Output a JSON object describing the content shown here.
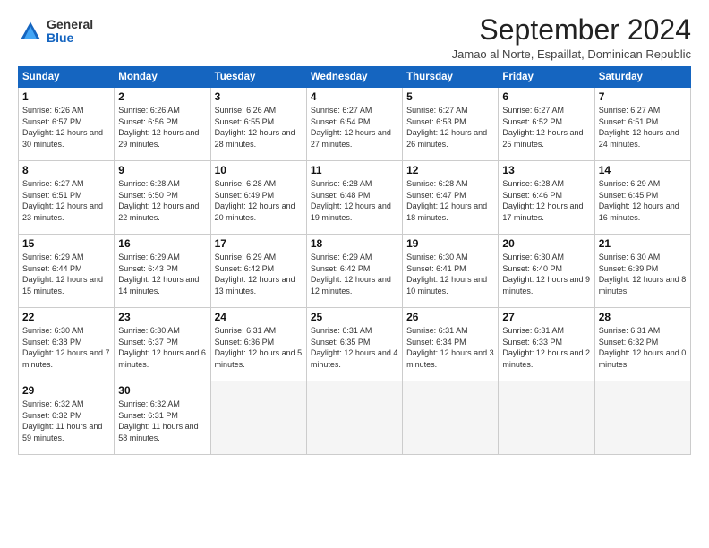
{
  "logo": {
    "general": "General",
    "blue": "Blue"
  },
  "header": {
    "title": "September 2024",
    "subtitle": "Jamao al Norte, Espaillat, Dominican Republic"
  },
  "weekdays": [
    "Sunday",
    "Monday",
    "Tuesday",
    "Wednesday",
    "Thursday",
    "Friday",
    "Saturday"
  ],
  "weeks": [
    [
      {
        "day": 1,
        "sunrise": "6:26 AM",
        "sunset": "6:57 PM",
        "daylight": "12 hours and 30 minutes."
      },
      {
        "day": 2,
        "sunrise": "6:26 AM",
        "sunset": "6:56 PM",
        "daylight": "12 hours and 29 minutes."
      },
      {
        "day": 3,
        "sunrise": "6:26 AM",
        "sunset": "6:55 PM",
        "daylight": "12 hours and 28 minutes."
      },
      {
        "day": 4,
        "sunrise": "6:27 AM",
        "sunset": "6:54 PM",
        "daylight": "12 hours and 27 minutes."
      },
      {
        "day": 5,
        "sunrise": "6:27 AM",
        "sunset": "6:53 PM",
        "daylight": "12 hours and 26 minutes."
      },
      {
        "day": 6,
        "sunrise": "6:27 AM",
        "sunset": "6:52 PM",
        "daylight": "12 hours and 25 minutes."
      },
      {
        "day": 7,
        "sunrise": "6:27 AM",
        "sunset": "6:51 PM",
        "daylight": "12 hours and 24 minutes."
      }
    ],
    [
      {
        "day": 8,
        "sunrise": "6:27 AM",
        "sunset": "6:51 PM",
        "daylight": "12 hours and 23 minutes."
      },
      {
        "day": 9,
        "sunrise": "6:28 AM",
        "sunset": "6:50 PM",
        "daylight": "12 hours and 22 minutes."
      },
      {
        "day": 10,
        "sunrise": "6:28 AM",
        "sunset": "6:49 PM",
        "daylight": "12 hours and 20 minutes."
      },
      {
        "day": 11,
        "sunrise": "6:28 AM",
        "sunset": "6:48 PM",
        "daylight": "12 hours and 19 minutes."
      },
      {
        "day": 12,
        "sunrise": "6:28 AM",
        "sunset": "6:47 PM",
        "daylight": "12 hours and 18 minutes."
      },
      {
        "day": 13,
        "sunrise": "6:28 AM",
        "sunset": "6:46 PM",
        "daylight": "12 hours and 17 minutes."
      },
      {
        "day": 14,
        "sunrise": "6:29 AM",
        "sunset": "6:45 PM",
        "daylight": "12 hours and 16 minutes."
      }
    ],
    [
      {
        "day": 15,
        "sunrise": "6:29 AM",
        "sunset": "6:44 PM",
        "daylight": "12 hours and 15 minutes."
      },
      {
        "day": 16,
        "sunrise": "6:29 AM",
        "sunset": "6:43 PM",
        "daylight": "12 hours and 14 minutes."
      },
      {
        "day": 17,
        "sunrise": "6:29 AM",
        "sunset": "6:42 PM",
        "daylight": "12 hours and 13 minutes."
      },
      {
        "day": 18,
        "sunrise": "6:29 AM",
        "sunset": "6:42 PM",
        "daylight": "12 hours and 12 minutes."
      },
      {
        "day": 19,
        "sunrise": "6:30 AM",
        "sunset": "6:41 PM",
        "daylight": "12 hours and 10 minutes."
      },
      {
        "day": 20,
        "sunrise": "6:30 AM",
        "sunset": "6:40 PM",
        "daylight": "12 hours and 9 minutes."
      },
      {
        "day": 21,
        "sunrise": "6:30 AM",
        "sunset": "6:39 PM",
        "daylight": "12 hours and 8 minutes."
      }
    ],
    [
      {
        "day": 22,
        "sunrise": "6:30 AM",
        "sunset": "6:38 PM",
        "daylight": "12 hours and 7 minutes."
      },
      {
        "day": 23,
        "sunrise": "6:30 AM",
        "sunset": "6:37 PM",
        "daylight": "12 hours and 6 minutes."
      },
      {
        "day": 24,
        "sunrise": "6:31 AM",
        "sunset": "6:36 PM",
        "daylight": "12 hours and 5 minutes."
      },
      {
        "day": 25,
        "sunrise": "6:31 AM",
        "sunset": "6:35 PM",
        "daylight": "12 hours and 4 minutes."
      },
      {
        "day": 26,
        "sunrise": "6:31 AM",
        "sunset": "6:34 PM",
        "daylight": "12 hours and 3 minutes."
      },
      {
        "day": 27,
        "sunrise": "6:31 AM",
        "sunset": "6:33 PM",
        "daylight": "12 hours and 2 minutes."
      },
      {
        "day": 28,
        "sunrise": "6:31 AM",
        "sunset": "6:32 PM",
        "daylight": "12 hours and 0 minutes."
      }
    ],
    [
      {
        "day": 29,
        "sunrise": "6:32 AM",
        "sunset": "6:32 PM",
        "daylight": "11 hours and 59 minutes."
      },
      {
        "day": 30,
        "sunrise": "6:32 AM",
        "sunset": "6:31 PM",
        "daylight": "11 hours and 58 minutes."
      },
      null,
      null,
      null,
      null,
      null
    ]
  ]
}
